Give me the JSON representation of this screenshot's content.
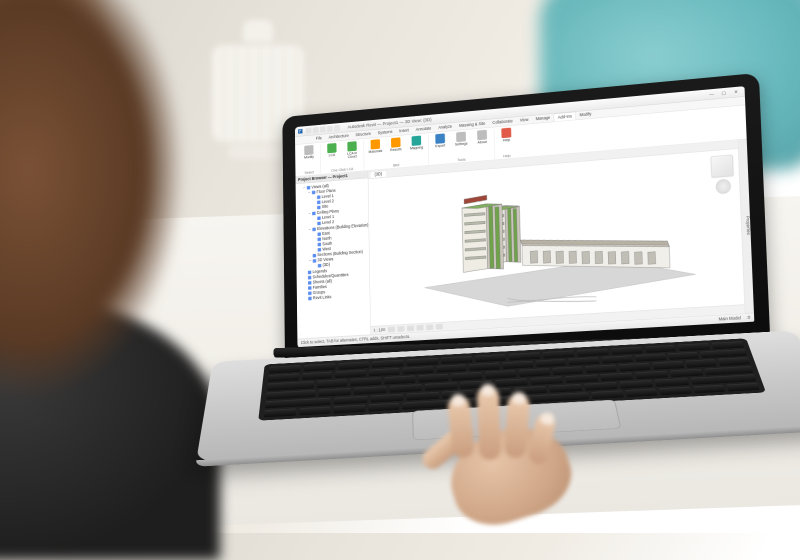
{
  "scene": {
    "description": "Over-the-shoulder photo of a person using a silver laptop on a white desk; a white lantern and teal cushion are in the blurred background.",
    "laptop_brand_hint": "Silver MacBook-style laptop"
  },
  "app": {
    "name": "Autodesk Revit",
    "titlebar": {
      "logo_label": "Revit",
      "quick_access": [
        "Open",
        "Save",
        "Undo",
        "Redo",
        "Print"
      ],
      "title": "Autodesk Revit — Project1 — 3D View: {3D}",
      "window_controls": {
        "minimize": "—",
        "maximize": "▢",
        "close": "✕"
      }
    },
    "ribbon": {
      "tabs": [
        "File",
        "Architecture",
        "Structure",
        "Systems",
        "Insert",
        "Annotate",
        "Analyze",
        "Massing & Site",
        "Collaborate",
        "View",
        "Manage",
        "Add-Ins",
        "Modify"
      ],
      "active_tab": "Add-Ins",
      "groups": [
        {
          "name": "Select",
          "buttons": [
            {
              "label": "Modify",
              "color": "grey"
            }
          ]
        },
        {
          "name": "One Click LCA",
          "buttons": [
            {
              "label": "LCA",
              "color": "green"
            },
            {
              "label": "LCA in Cloud",
              "color": "green"
            }
          ]
        },
        {
          "name": "BIM",
          "buttons": [
            {
              "label": "Materials",
              "color": "orange"
            },
            {
              "label": "Results",
              "color": "orange"
            },
            {
              "label": "Mapping",
              "color": "teal"
            }
          ]
        },
        {
          "name": "Tools",
          "buttons": [
            {
              "label": "Export",
              "color": "blue"
            },
            {
              "label": "Settings",
              "color": "grey"
            },
            {
              "label": "About",
              "color": "grey"
            }
          ]
        },
        {
          "name": "Help",
          "buttons": [
            {
              "label": "Help",
              "color": "red"
            }
          ]
        }
      ]
    },
    "project_browser": {
      "title": "Project Browser — Project1",
      "tree": [
        {
          "label": "Views (all)",
          "children": [
            {
              "label": "Floor Plans",
              "children": [
                {
                  "label": "Level 1"
                },
                {
                  "label": "Level 2"
                },
                {
                  "label": "Site"
                }
              ]
            },
            {
              "label": "Ceiling Plans",
              "children": [
                {
                  "label": "Level 1"
                },
                {
                  "label": "Level 2"
                }
              ]
            },
            {
              "label": "Elevations (Building Elevation)",
              "children": [
                {
                  "label": "East"
                },
                {
                  "label": "North"
                },
                {
                  "label": "South"
                },
                {
                  "label": "West"
                }
              ]
            },
            {
              "label": "Sections (Building Section)"
            },
            {
              "label": "3D Views",
              "children": [
                {
                  "label": "{3D}"
                }
              ]
            }
          ]
        },
        {
          "label": "Legends"
        },
        {
          "label": "Schedules/Quantities"
        },
        {
          "label": "Sheets (all)"
        },
        {
          "label": "Families"
        },
        {
          "label": "Groups"
        },
        {
          "label": "Revit Links"
        }
      ]
    },
    "view": {
      "active_view_tab": "{3D}",
      "viewcube_label": "ViewCube",
      "view_control_bar": {
        "scale": "1 : 100",
        "detail_level": "Fine",
        "visual_style": "Shaded",
        "items": [
          "Sun Path",
          "Shadows",
          "Crop",
          "Hide/Isolate"
        ]
      },
      "model_description": "3D isometric of a two-tower residential building connected to a long low warehouse wing on a flat site slab."
    },
    "properties_panel": {
      "title": "Properties"
    },
    "statusbar": {
      "hint": "Click to select, TAB for alternates, CTRL adds, SHIFT unselects.",
      "selection": ":0",
      "filter_label": "Main Model"
    }
  }
}
